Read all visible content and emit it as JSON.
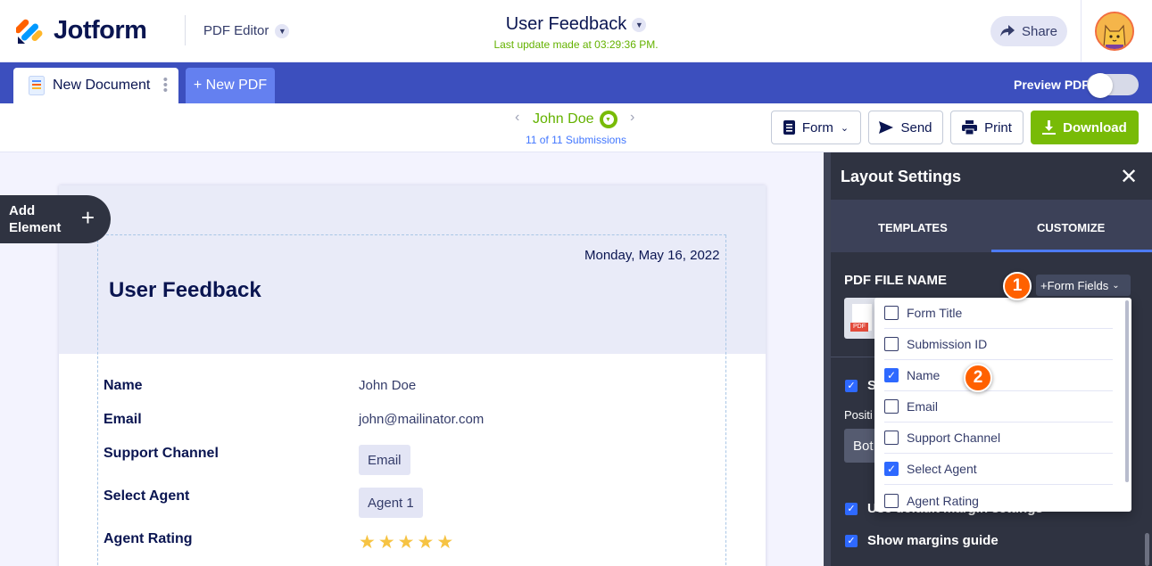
{
  "header": {
    "logo_text": "Jotform",
    "editor_label": "PDF Editor",
    "doc_title": "User Feedback",
    "last_update": "Last update made at 03:29:36 PM.",
    "share_label": "Share"
  },
  "tabs": {
    "document_label": "New Document",
    "new_pdf_label": "+ New PDF",
    "preview_label": "Preview PDF",
    "preview_on": false
  },
  "submission_nav": {
    "name": "John Doe",
    "count": "11 of 11 Submissions"
  },
  "toolbar": {
    "form_label": "Form",
    "send_label": "Send",
    "print_label": "Print",
    "download_label": "Download"
  },
  "canvas": {
    "add_element_line1": "Add",
    "add_element_line2": "Element",
    "date": "Monday, May 16, 2022",
    "title": "User Feedback",
    "fields": [
      {
        "label": "Name",
        "value": "John Doe"
      },
      {
        "label": "Email",
        "value": "john@mailinator.com"
      },
      {
        "label": "Support Channel",
        "value": "Email"
      },
      {
        "label": "Select Agent",
        "value": "Agent 1"
      },
      {
        "label": "Agent Rating",
        "rating": 5
      }
    ]
  },
  "panel": {
    "title": "Layout Settings",
    "tab_templates": "TEMPLATES",
    "tab_customize": "CUSTOMIZE",
    "pdf_file_name_label": "PDF FILE NAME",
    "form_fields_label": "+Form Fields",
    "pdf_tag": "PDF",
    "partial_check_label": "S",
    "position_label": "Positi",
    "position_value": "Bot",
    "margin_default_label": "Use default margin settings",
    "margin_guide_label": "Show margins guide"
  },
  "dropdown": {
    "items": [
      {
        "label": "Form Title",
        "checked": false
      },
      {
        "label": "Submission ID",
        "checked": false
      },
      {
        "label": "Name",
        "checked": true
      },
      {
        "label": "Email",
        "checked": false
      },
      {
        "label": "Support Channel",
        "checked": false
      },
      {
        "label": "Select Agent",
        "checked": true
      },
      {
        "label": "Agent Rating",
        "checked": false
      }
    ]
  },
  "annotations": {
    "badge_1": "1",
    "badge_2": "2"
  },
  "colors": {
    "brand_navy": "#0a1551",
    "tabbar_blue": "#3c4fbe",
    "download_green": "#78bb07",
    "badge_orange": "#ff6100",
    "panel_dark": "#2f3341",
    "check_blue": "#2e69ff"
  }
}
